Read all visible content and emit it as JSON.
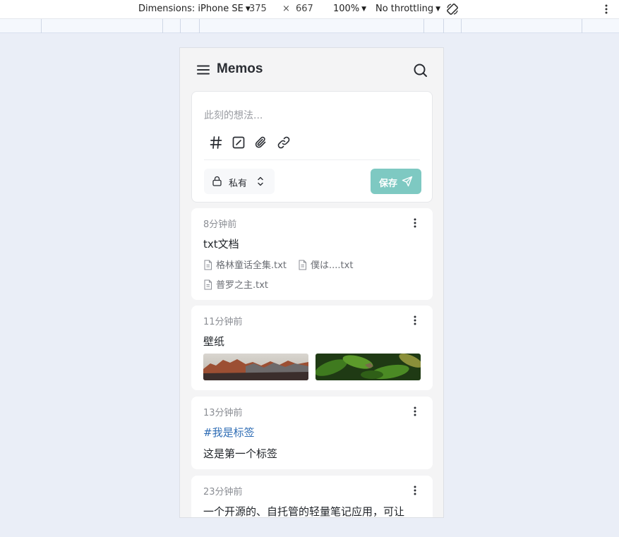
{
  "devtools": {
    "dimensions_label": "Dimensions: iPhone SE",
    "width": "375",
    "times": "×",
    "height": "667",
    "zoom": "100%",
    "throttling": "No throttling"
  },
  "app": {
    "title": "Memos",
    "editor": {
      "placeholder": "此刻的想法...",
      "visibility_label": "私有",
      "save_label": "保存"
    },
    "memos": [
      {
        "time": "8分钟前",
        "text": "txt文档",
        "attachments": [
          "格林童话全集.txt",
          "僕は....txt",
          "普罗之主.txt"
        ]
      },
      {
        "time": "11分钟前",
        "text": "壁纸",
        "images": [
          "mountain-landscape",
          "green-leaves-butterfly"
        ]
      },
      {
        "time": "13分钟前",
        "tag": "#我是标签",
        "text": "这是第一个标签"
      },
      {
        "time": "23分钟前",
        "text": "一个开源的、自托管的轻量笔记应用，可让"
      }
    ]
  },
  "colors": {
    "page_bg": "#eaeef7",
    "app_bg": "#f4f4f5",
    "save_button": "#7ec9c2",
    "tag": "#2f6db5"
  }
}
